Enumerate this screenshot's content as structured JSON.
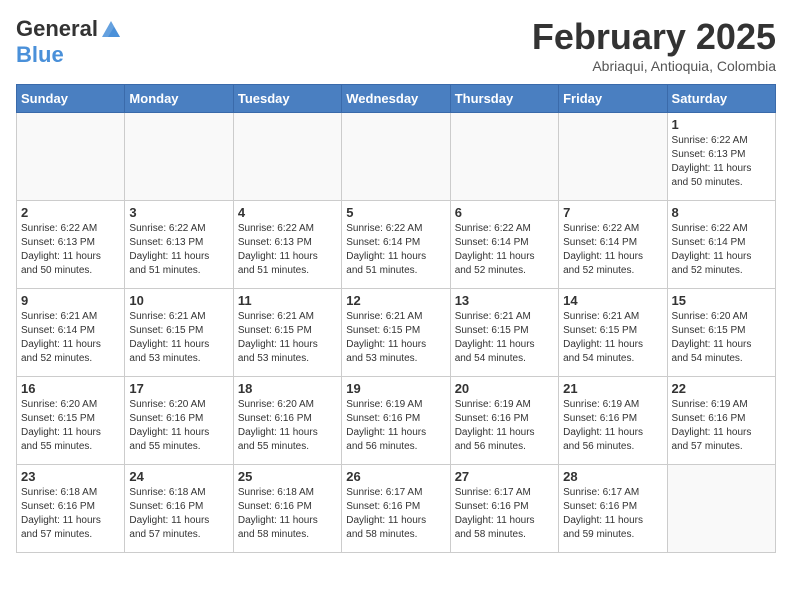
{
  "header": {
    "logo_general": "General",
    "logo_blue": "Blue",
    "month_title": "February 2025",
    "location": "Abriaqui, Antioquia, Colombia"
  },
  "calendar": {
    "days_of_week": [
      "Sunday",
      "Monday",
      "Tuesday",
      "Wednesday",
      "Thursday",
      "Friday",
      "Saturday"
    ],
    "weeks": [
      [
        {
          "day": "",
          "info": ""
        },
        {
          "day": "",
          "info": ""
        },
        {
          "day": "",
          "info": ""
        },
        {
          "day": "",
          "info": ""
        },
        {
          "day": "",
          "info": ""
        },
        {
          "day": "",
          "info": ""
        },
        {
          "day": "1",
          "info": "Sunrise: 6:22 AM\nSunset: 6:13 PM\nDaylight: 11 hours\nand 50 minutes."
        }
      ],
      [
        {
          "day": "2",
          "info": "Sunrise: 6:22 AM\nSunset: 6:13 PM\nDaylight: 11 hours\nand 50 minutes."
        },
        {
          "day": "3",
          "info": "Sunrise: 6:22 AM\nSunset: 6:13 PM\nDaylight: 11 hours\nand 51 minutes."
        },
        {
          "day": "4",
          "info": "Sunrise: 6:22 AM\nSunset: 6:13 PM\nDaylight: 11 hours\nand 51 minutes."
        },
        {
          "day": "5",
          "info": "Sunrise: 6:22 AM\nSunset: 6:14 PM\nDaylight: 11 hours\nand 51 minutes."
        },
        {
          "day": "6",
          "info": "Sunrise: 6:22 AM\nSunset: 6:14 PM\nDaylight: 11 hours\nand 52 minutes."
        },
        {
          "day": "7",
          "info": "Sunrise: 6:22 AM\nSunset: 6:14 PM\nDaylight: 11 hours\nand 52 minutes."
        },
        {
          "day": "8",
          "info": "Sunrise: 6:22 AM\nSunset: 6:14 PM\nDaylight: 11 hours\nand 52 minutes."
        }
      ],
      [
        {
          "day": "9",
          "info": "Sunrise: 6:21 AM\nSunset: 6:14 PM\nDaylight: 11 hours\nand 52 minutes."
        },
        {
          "day": "10",
          "info": "Sunrise: 6:21 AM\nSunset: 6:15 PM\nDaylight: 11 hours\nand 53 minutes."
        },
        {
          "day": "11",
          "info": "Sunrise: 6:21 AM\nSunset: 6:15 PM\nDaylight: 11 hours\nand 53 minutes."
        },
        {
          "day": "12",
          "info": "Sunrise: 6:21 AM\nSunset: 6:15 PM\nDaylight: 11 hours\nand 53 minutes."
        },
        {
          "day": "13",
          "info": "Sunrise: 6:21 AM\nSunset: 6:15 PM\nDaylight: 11 hours\nand 54 minutes."
        },
        {
          "day": "14",
          "info": "Sunrise: 6:21 AM\nSunset: 6:15 PM\nDaylight: 11 hours\nand 54 minutes."
        },
        {
          "day": "15",
          "info": "Sunrise: 6:20 AM\nSunset: 6:15 PM\nDaylight: 11 hours\nand 54 minutes."
        }
      ],
      [
        {
          "day": "16",
          "info": "Sunrise: 6:20 AM\nSunset: 6:15 PM\nDaylight: 11 hours\nand 55 minutes."
        },
        {
          "day": "17",
          "info": "Sunrise: 6:20 AM\nSunset: 6:16 PM\nDaylight: 11 hours\nand 55 minutes."
        },
        {
          "day": "18",
          "info": "Sunrise: 6:20 AM\nSunset: 6:16 PM\nDaylight: 11 hours\nand 55 minutes."
        },
        {
          "day": "19",
          "info": "Sunrise: 6:19 AM\nSunset: 6:16 PM\nDaylight: 11 hours\nand 56 minutes."
        },
        {
          "day": "20",
          "info": "Sunrise: 6:19 AM\nSunset: 6:16 PM\nDaylight: 11 hours\nand 56 minutes."
        },
        {
          "day": "21",
          "info": "Sunrise: 6:19 AM\nSunset: 6:16 PM\nDaylight: 11 hours\nand 56 minutes."
        },
        {
          "day": "22",
          "info": "Sunrise: 6:19 AM\nSunset: 6:16 PM\nDaylight: 11 hours\nand 57 minutes."
        }
      ],
      [
        {
          "day": "23",
          "info": "Sunrise: 6:18 AM\nSunset: 6:16 PM\nDaylight: 11 hours\nand 57 minutes."
        },
        {
          "day": "24",
          "info": "Sunrise: 6:18 AM\nSunset: 6:16 PM\nDaylight: 11 hours\nand 57 minutes."
        },
        {
          "day": "25",
          "info": "Sunrise: 6:18 AM\nSunset: 6:16 PM\nDaylight: 11 hours\nand 58 minutes."
        },
        {
          "day": "26",
          "info": "Sunrise: 6:17 AM\nSunset: 6:16 PM\nDaylight: 11 hours\nand 58 minutes."
        },
        {
          "day": "27",
          "info": "Sunrise: 6:17 AM\nSunset: 6:16 PM\nDaylight: 11 hours\nand 58 minutes."
        },
        {
          "day": "28",
          "info": "Sunrise: 6:17 AM\nSunset: 6:16 PM\nDaylight: 11 hours\nand 59 minutes."
        },
        {
          "day": "",
          "info": ""
        }
      ]
    ]
  }
}
